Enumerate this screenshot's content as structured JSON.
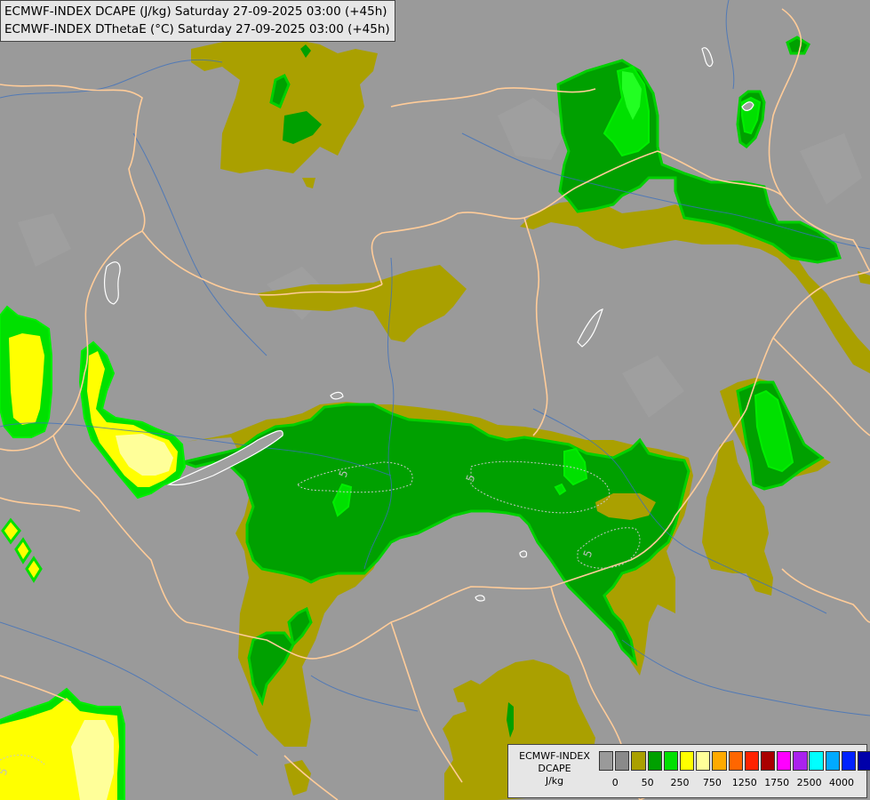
{
  "header": {
    "line1": "ECMWF-INDEX DCAPE (J/kg) Saturday 27-09-2025 03:00 (+45h)",
    "line2": "ECMWF-INDEX DThetaE (°C) Saturday 27-09-2025 03:00 (+45h)"
  },
  "legend": {
    "title_line1": "ECMWF-INDEX",
    "title_line2": "DCAPE",
    "unit": "J/kg",
    "colors": [
      "#9a9a9a",
      "#8a8a8a",
      "#aaa000",
      "#00a000",
      "#00e000",
      "#ffff00",
      "#ffff99",
      "#ffaa00",
      "#ff6600",
      "#ff2200",
      "#aa0000",
      "#ff00ff",
      "#aa22ee",
      "#00ffff",
      "#00aaff",
      "#0022ff",
      "#0000aa"
    ],
    "tick_labels": [
      "0",
      "50",
      "250",
      "750",
      "1250",
      "1750",
      "2500",
      "4000"
    ]
  },
  "map": {
    "contour_labels": [
      "5",
      "5",
      "5",
      "5"
    ],
    "fill_colors": {
      "olive": "#aaa000",
      "green": "#00a000",
      "lightgreen": "#00e000",
      "yellow": "#ffff00",
      "lightyellow": "#ffff99"
    }
  }
}
